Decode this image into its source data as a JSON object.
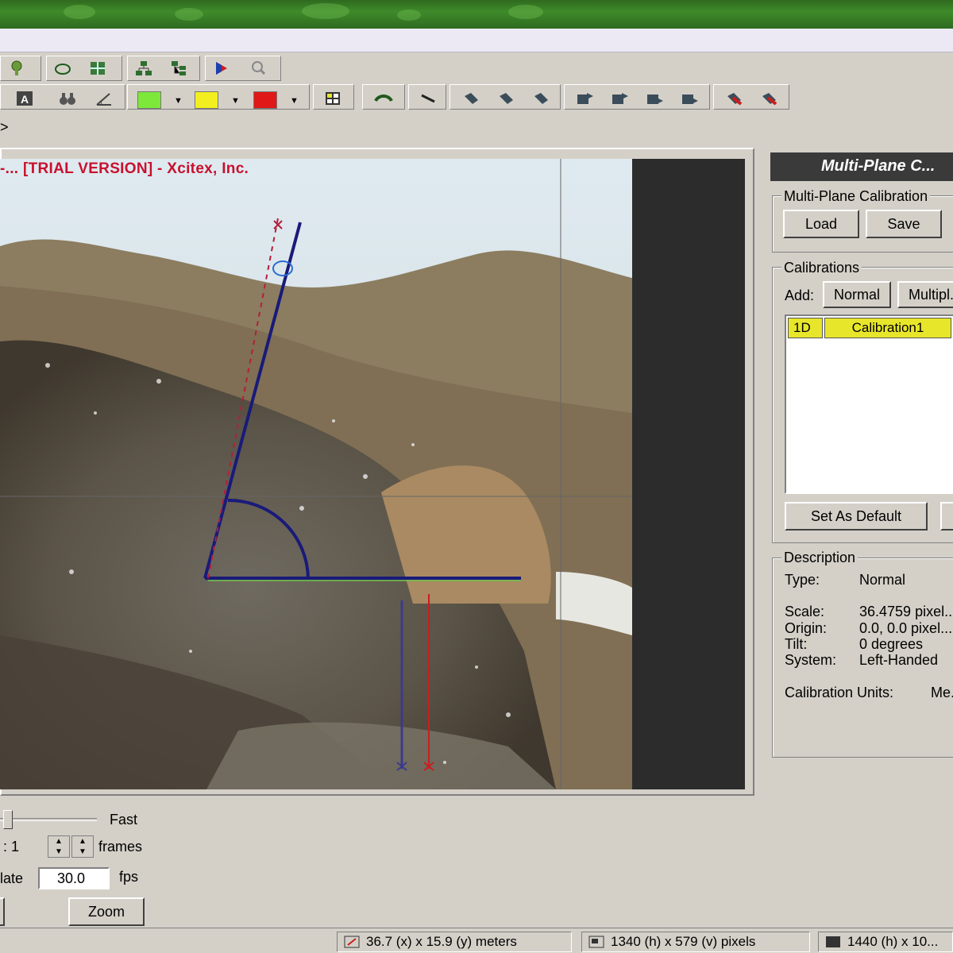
{
  "overlay": {
    "watermark": "-... [TRIAL VERSION] - Xcitex, Inc."
  },
  "toolbar": {
    "row1": [
      "help-icon",
      "ellipse-icon",
      "grid-icon",
      "network-icon",
      "tree-icon",
      "play-track-icon",
      "search-icon"
    ],
    "row2": [
      "text-icon",
      "binoculars-icon",
      "measure-icon",
      "line-color",
      "marker-color",
      "highlight-color",
      "table-icon",
      "link-icon",
      "line-tool-icon",
      "marker-1-icon",
      "marker-2-icon",
      "marker-3-icon",
      "export-1-icon",
      "export-2-icon",
      "export-3-icon",
      "export-4-icon",
      "delete-1-icon",
      "delete-2-icon"
    ],
    "colors": {
      "line": "#7de83a",
      "marker": "#f3ee1f",
      "highlight": "#e01818"
    }
  },
  "infoline": {
    "text": ">"
  },
  "panel": {
    "title": "Multi-Plane C...",
    "multi_plane": {
      "label": "Multi-Plane Calibration",
      "load": "Load",
      "save": "Save"
    },
    "calibrations": {
      "label": "Calibrations",
      "add_label": "Add:",
      "normal": "Normal",
      "multiplane": "Multipl...",
      "list": [
        {
          "type": "1D",
          "name": "Calibration1"
        }
      ],
      "set_default": "Set As Default"
    },
    "description": {
      "label": "Description",
      "type_label": "Type:",
      "type_value": "Normal",
      "scale_label": "Scale:",
      "scale_value": "36.4759 pixel...",
      "origin_label": "Origin:",
      "origin_value": "0.0, 0.0 pixel...",
      "tilt_label": "Tilt:",
      "tilt_value": "0 degrees",
      "system_label": "System:",
      "system_value": "Left-Handed",
      "units_label": "Calibration Units:",
      "units_value": "Me..."
    }
  },
  "playback": {
    "speed_fast": "Fast",
    "step_label": ": 1",
    "frames_label": "frames",
    "rate_label": "late",
    "rate_value": "30.0",
    "fps_label": "fps",
    "zoom_label": "Zoom"
  },
  "status": {
    "coords": "36.7 (x) x 15.9 (y) meters",
    "selection": "1340 (h) x 579 (v) pixels",
    "image": "1440 (h) x 10..."
  }
}
